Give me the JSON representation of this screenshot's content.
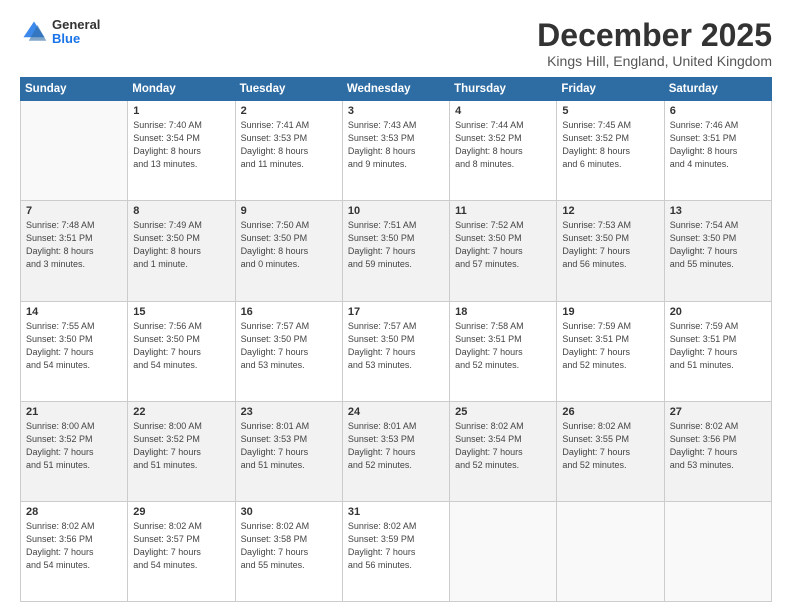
{
  "logo": {
    "general": "General",
    "blue": "Blue"
  },
  "title": "December 2025",
  "location": "Kings Hill, England, United Kingdom",
  "days_header": [
    "Sunday",
    "Monday",
    "Tuesday",
    "Wednesday",
    "Thursday",
    "Friday",
    "Saturday"
  ],
  "weeks": [
    [
      {
        "num": "",
        "info": ""
      },
      {
        "num": "1",
        "info": "Sunrise: 7:40 AM\nSunset: 3:54 PM\nDaylight: 8 hours\nand 13 minutes."
      },
      {
        "num": "2",
        "info": "Sunrise: 7:41 AM\nSunset: 3:53 PM\nDaylight: 8 hours\nand 11 minutes."
      },
      {
        "num": "3",
        "info": "Sunrise: 7:43 AM\nSunset: 3:53 PM\nDaylight: 8 hours\nand 9 minutes."
      },
      {
        "num": "4",
        "info": "Sunrise: 7:44 AM\nSunset: 3:52 PM\nDaylight: 8 hours\nand 8 minutes."
      },
      {
        "num": "5",
        "info": "Sunrise: 7:45 AM\nSunset: 3:52 PM\nDaylight: 8 hours\nand 6 minutes."
      },
      {
        "num": "6",
        "info": "Sunrise: 7:46 AM\nSunset: 3:51 PM\nDaylight: 8 hours\nand 4 minutes."
      }
    ],
    [
      {
        "num": "7",
        "info": "Sunrise: 7:48 AM\nSunset: 3:51 PM\nDaylight: 8 hours\nand 3 minutes."
      },
      {
        "num": "8",
        "info": "Sunrise: 7:49 AM\nSunset: 3:50 PM\nDaylight: 8 hours\nand 1 minute."
      },
      {
        "num": "9",
        "info": "Sunrise: 7:50 AM\nSunset: 3:50 PM\nDaylight: 8 hours\nand 0 minutes."
      },
      {
        "num": "10",
        "info": "Sunrise: 7:51 AM\nSunset: 3:50 PM\nDaylight: 7 hours\nand 59 minutes."
      },
      {
        "num": "11",
        "info": "Sunrise: 7:52 AM\nSunset: 3:50 PM\nDaylight: 7 hours\nand 57 minutes."
      },
      {
        "num": "12",
        "info": "Sunrise: 7:53 AM\nSunset: 3:50 PM\nDaylight: 7 hours\nand 56 minutes."
      },
      {
        "num": "13",
        "info": "Sunrise: 7:54 AM\nSunset: 3:50 PM\nDaylight: 7 hours\nand 55 minutes."
      }
    ],
    [
      {
        "num": "14",
        "info": "Sunrise: 7:55 AM\nSunset: 3:50 PM\nDaylight: 7 hours\nand 54 minutes."
      },
      {
        "num": "15",
        "info": "Sunrise: 7:56 AM\nSunset: 3:50 PM\nDaylight: 7 hours\nand 54 minutes."
      },
      {
        "num": "16",
        "info": "Sunrise: 7:57 AM\nSunset: 3:50 PM\nDaylight: 7 hours\nand 53 minutes."
      },
      {
        "num": "17",
        "info": "Sunrise: 7:57 AM\nSunset: 3:50 PM\nDaylight: 7 hours\nand 53 minutes."
      },
      {
        "num": "18",
        "info": "Sunrise: 7:58 AM\nSunset: 3:51 PM\nDaylight: 7 hours\nand 52 minutes."
      },
      {
        "num": "19",
        "info": "Sunrise: 7:59 AM\nSunset: 3:51 PM\nDaylight: 7 hours\nand 52 minutes."
      },
      {
        "num": "20",
        "info": "Sunrise: 7:59 AM\nSunset: 3:51 PM\nDaylight: 7 hours\nand 51 minutes."
      }
    ],
    [
      {
        "num": "21",
        "info": "Sunrise: 8:00 AM\nSunset: 3:52 PM\nDaylight: 7 hours\nand 51 minutes."
      },
      {
        "num": "22",
        "info": "Sunrise: 8:00 AM\nSunset: 3:52 PM\nDaylight: 7 hours\nand 51 minutes."
      },
      {
        "num": "23",
        "info": "Sunrise: 8:01 AM\nSunset: 3:53 PM\nDaylight: 7 hours\nand 51 minutes."
      },
      {
        "num": "24",
        "info": "Sunrise: 8:01 AM\nSunset: 3:53 PM\nDaylight: 7 hours\nand 52 minutes."
      },
      {
        "num": "25",
        "info": "Sunrise: 8:02 AM\nSunset: 3:54 PM\nDaylight: 7 hours\nand 52 minutes."
      },
      {
        "num": "26",
        "info": "Sunrise: 8:02 AM\nSunset: 3:55 PM\nDaylight: 7 hours\nand 52 minutes."
      },
      {
        "num": "27",
        "info": "Sunrise: 8:02 AM\nSunset: 3:56 PM\nDaylight: 7 hours\nand 53 minutes."
      }
    ],
    [
      {
        "num": "28",
        "info": "Sunrise: 8:02 AM\nSunset: 3:56 PM\nDaylight: 7 hours\nand 54 minutes."
      },
      {
        "num": "29",
        "info": "Sunrise: 8:02 AM\nSunset: 3:57 PM\nDaylight: 7 hours\nand 54 minutes."
      },
      {
        "num": "30",
        "info": "Sunrise: 8:02 AM\nSunset: 3:58 PM\nDaylight: 7 hours\nand 55 minutes."
      },
      {
        "num": "31",
        "info": "Sunrise: 8:02 AM\nSunset: 3:59 PM\nDaylight: 7 hours\nand 56 minutes."
      },
      {
        "num": "",
        "info": ""
      },
      {
        "num": "",
        "info": ""
      },
      {
        "num": "",
        "info": ""
      }
    ]
  ]
}
